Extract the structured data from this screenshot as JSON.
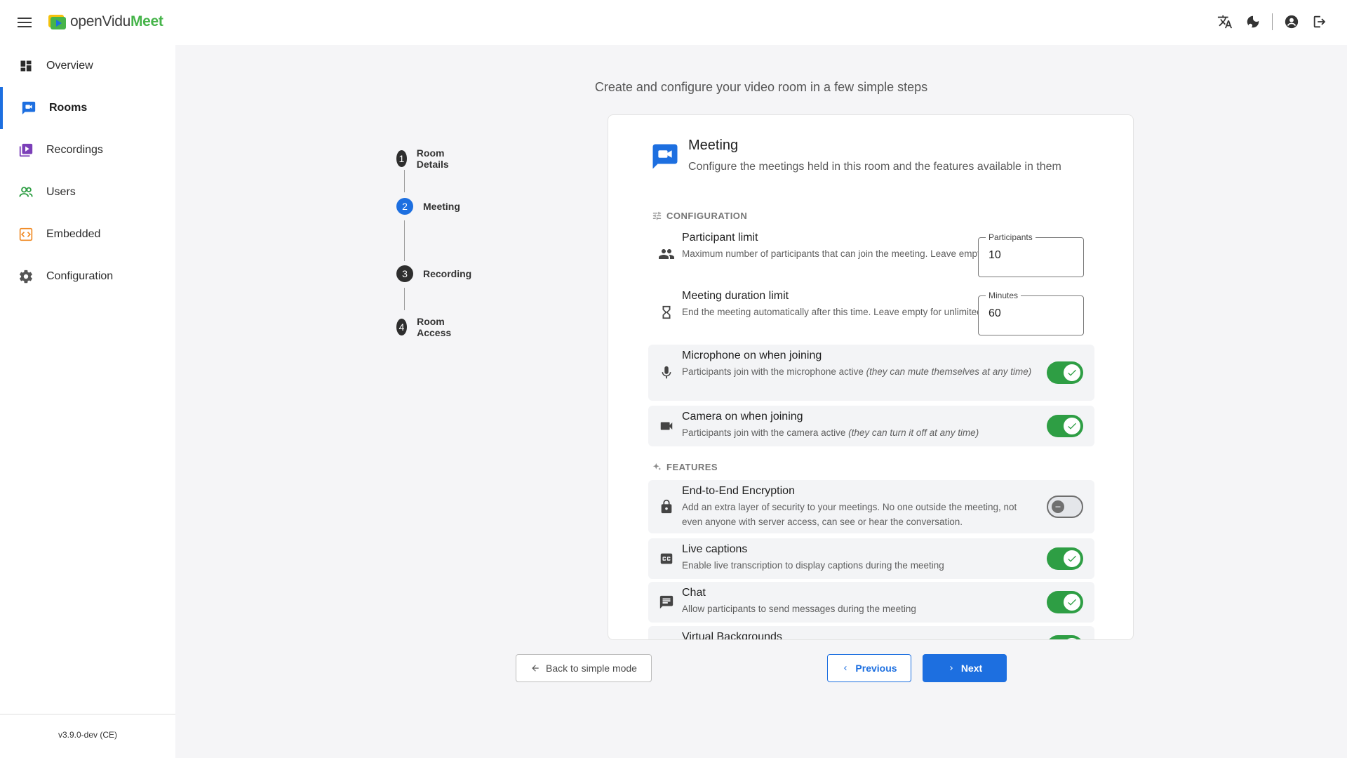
{
  "app": {
    "logo_prefix": "openVidu",
    "logo_suffix": "Meet"
  },
  "topbar": {
    "icons": [
      "translate-icon",
      "theme-toggle-icon",
      "account-icon",
      "logout-icon"
    ]
  },
  "sidebar": {
    "items": [
      {
        "label": "Overview",
        "icon": "dashboard-icon",
        "active": false
      },
      {
        "label": "Rooms",
        "icon": "rooms-icon",
        "active": true
      },
      {
        "label": "Recordings",
        "icon": "recordings-icon",
        "active": false
      },
      {
        "label": "Users",
        "icon": "users-icon",
        "active": false
      },
      {
        "label": "Embedded",
        "icon": "embedded-icon",
        "active": false
      },
      {
        "label": "Configuration",
        "icon": "gear-icon",
        "active": false
      }
    ],
    "version": "v3.9.0-dev (CE)"
  },
  "main": {
    "subtitle": "Create and configure your video room in a few simple steps"
  },
  "stepper": {
    "steps": [
      {
        "number": "1",
        "label": "Room Details"
      },
      {
        "number": "2",
        "label": "Meeting",
        "active": true
      },
      {
        "number": "3",
        "label": "Recording"
      },
      {
        "number": "4",
        "label": "Room Access"
      }
    ]
  },
  "card": {
    "title": "Meeting",
    "description": "Configure the meetings held in this room and the features available in them",
    "configuration_title": "CONFIGURATION",
    "features_title": "FEATURES",
    "participant_limit": {
      "title": "Participant limit",
      "description": "Maximum number of participants that can join the meeting. Leave empty for no limit",
      "field_label": "Participants",
      "value": "10"
    },
    "duration_limit": {
      "title": "Meeting duration limit",
      "description": "End the meeting automatically after this time. Leave empty for unlimited duration",
      "field_label": "Minutes",
      "value": "60"
    },
    "microphone": {
      "title": "Microphone on when joining",
      "description": "Participants join with the microphone active ",
      "description_italic": "(they can mute themselves at any time)",
      "enabled": true
    },
    "camera": {
      "title": "Camera on when joining",
      "description": "Participants join with the camera active ",
      "description_italic": "(they can turn it off at any time)",
      "enabled": true
    },
    "e2ee": {
      "title": "End-to-End Encryption",
      "description": "Add an extra layer of security to your meetings. No one outside the meeting, not even anyone with server access, can see or hear the conversation.",
      "enabled": false
    },
    "captions": {
      "title": "Live captions",
      "description": "Enable live transcription to display captions during the meeting",
      "enabled": true
    },
    "chat": {
      "title": "Chat",
      "description": "Allow participants to send messages during the meeting",
      "enabled": true
    },
    "backgrounds": {
      "title": "Virtual Backgrounds",
      "enabled": true
    }
  },
  "buttons": {
    "back": "Back to simple mode",
    "previous": "Previous",
    "next": "Next"
  },
  "colors": {
    "primary": "#1d6fe0",
    "toggle_on": "#2e9e44",
    "brand_green": "#46b44a"
  }
}
